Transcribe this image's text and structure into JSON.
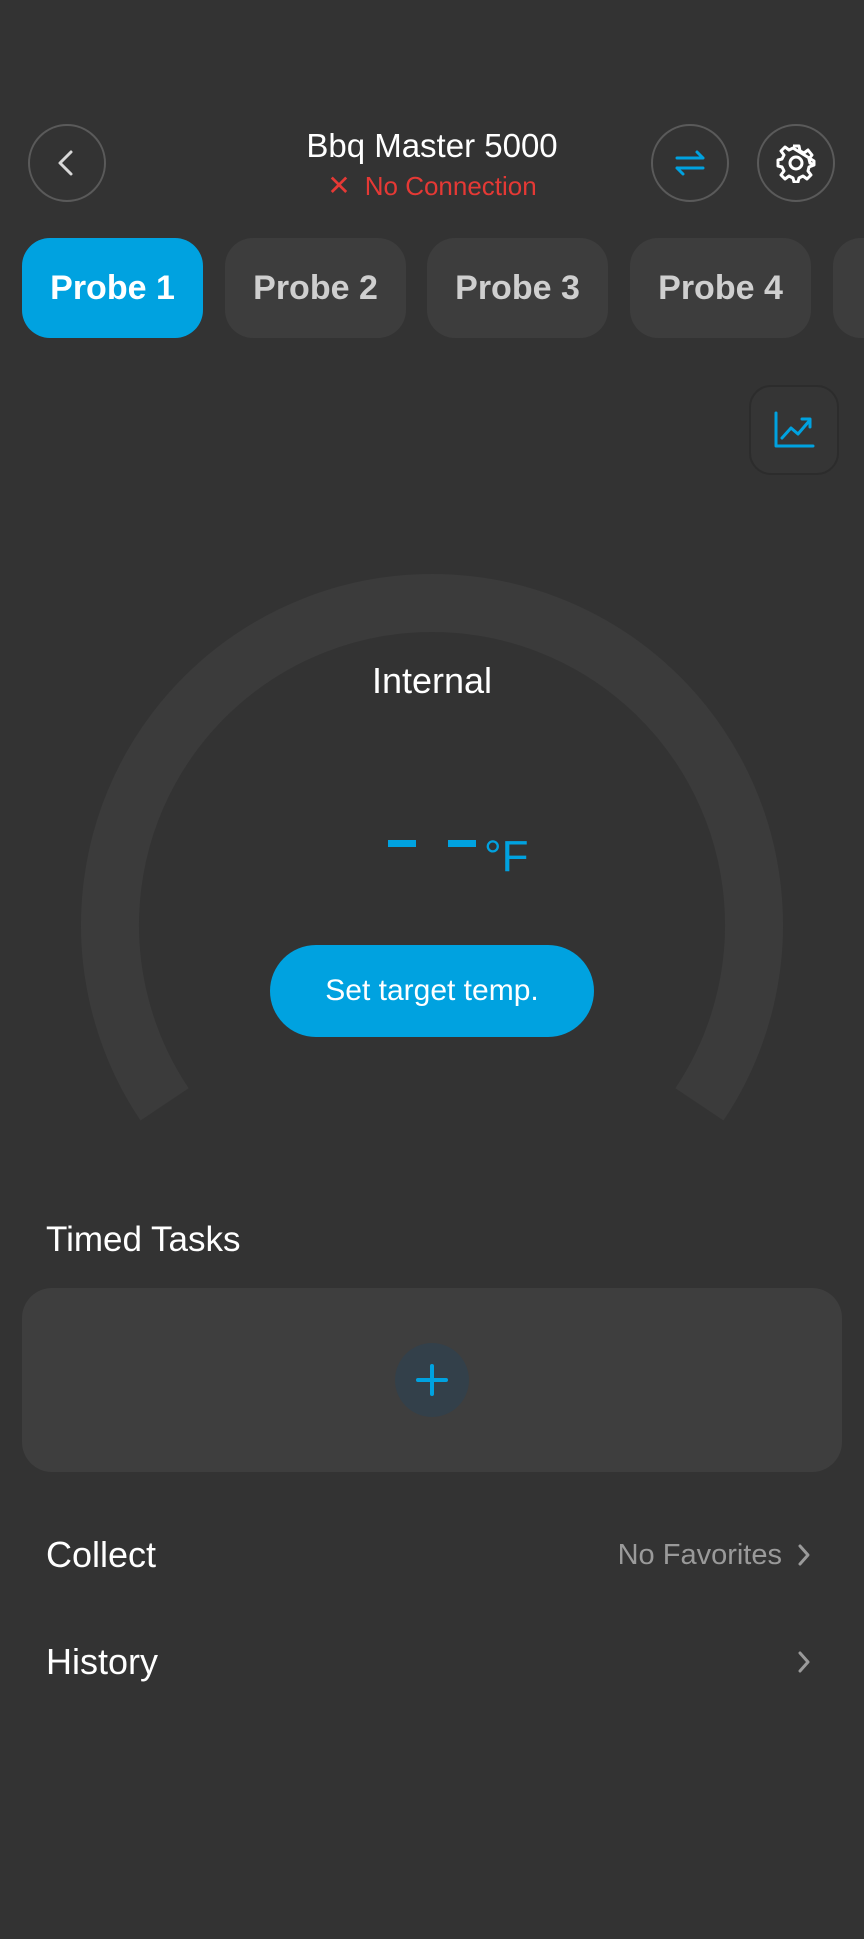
{
  "header": {
    "device_name": "Bbq Master 5000",
    "connection_status": "No Connection",
    "status_color": "#e53935"
  },
  "probes": {
    "tabs": [
      {
        "label": "Probe 1",
        "active": true
      },
      {
        "label": "Probe 2",
        "active": false
      },
      {
        "label": "Probe 3",
        "active": false
      },
      {
        "label": "Probe 4",
        "active": false
      }
    ]
  },
  "gauge": {
    "label": "Internal",
    "unit": "°F",
    "target_button": "Set target temp."
  },
  "timed_tasks": {
    "title": "Timed Tasks"
  },
  "collect": {
    "label": "Collect",
    "value": "No Favorites"
  },
  "history": {
    "label": "History"
  },
  "colors": {
    "accent": "#00a2e0",
    "background": "#333333",
    "card": "#3e3e3e"
  }
}
